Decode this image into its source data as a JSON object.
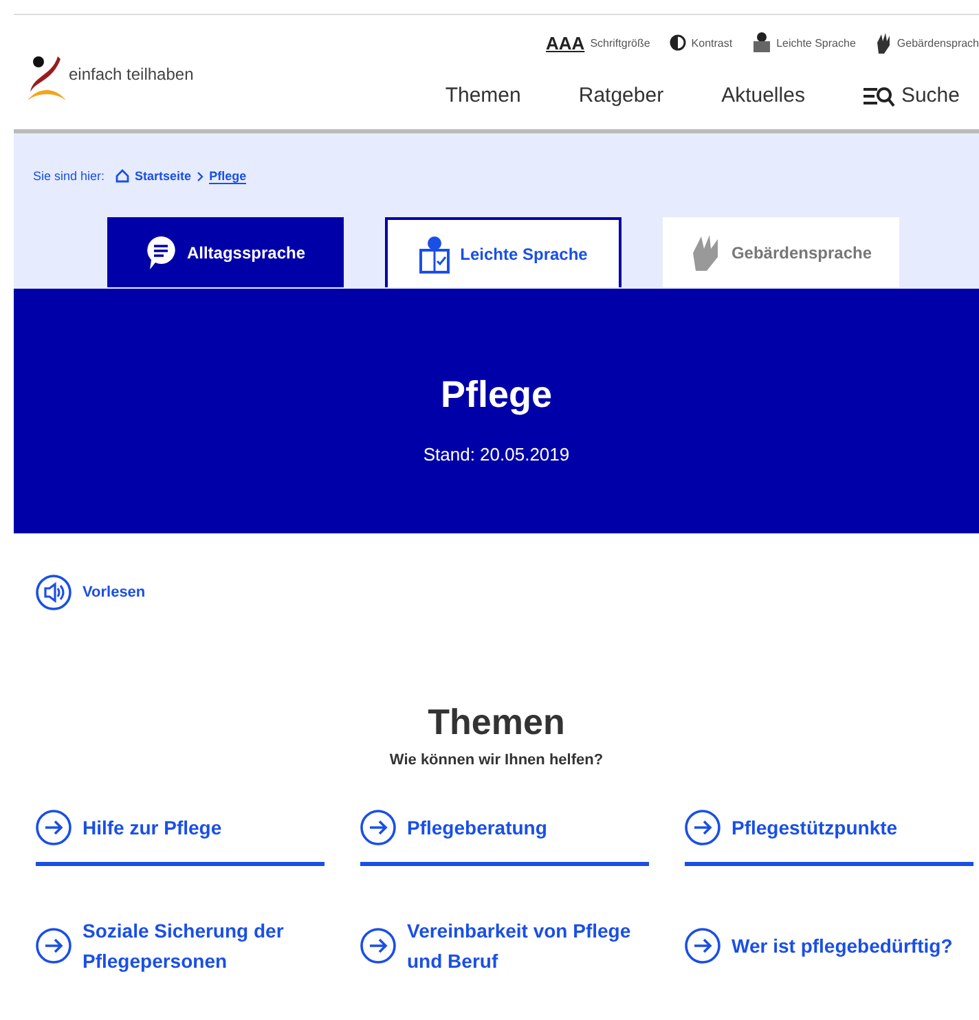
{
  "header": {
    "logo_text": "einfach teilhaben",
    "utility_links": [
      {
        "kind": "fontsize",
        "glyph": "AAA",
        "label": "Schriftgröße"
      },
      {
        "kind": "contrast",
        "label": "Kontrast"
      },
      {
        "kind": "easy",
        "label": "Leichte Sprache"
      },
      {
        "kind": "sign",
        "label": "Gebärdensprach"
      }
    ],
    "nav": [
      {
        "kind": "link",
        "label": "Themen"
      },
      {
        "kind": "link",
        "label": "Ratgeber"
      },
      {
        "kind": "link",
        "label": "Aktuelles"
      },
      {
        "kind": "search",
        "label": "Suche"
      }
    ]
  },
  "breadcrumb": {
    "prefix": "Sie sind hier:",
    "items": [
      {
        "label": "Startseite",
        "current": false
      },
      {
        "label": "Pflege",
        "current": true
      }
    ]
  },
  "tabs": [
    {
      "kind": "speech",
      "label": "Alltagssprache",
      "selected": true,
      "focused": false
    },
    {
      "kind": "easy",
      "label": "Leichte Sprache",
      "selected": false,
      "focused": true
    },
    {
      "kind": "sign",
      "label": "Gebärdensprache",
      "selected": false,
      "focused": false
    }
  ],
  "hero": {
    "title": "Pflege",
    "date": "Stand: 20.05.2019"
  },
  "read_aloud": "Vorlesen",
  "topics": {
    "title": "Themen",
    "subtitle": "Wie können wir Ihnen helfen?",
    "items": [
      {
        "label": "Hilfe zur Pflege"
      },
      {
        "label": "Pflegeberatung"
      },
      {
        "label": "Pflegestützpunkte"
      },
      {
        "label": "Soziale Sicherung der Pflegepersonen"
      },
      {
        "label": "Vereinbarkeit von Pflege und Beruf"
      },
      {
        "label": "Wer ist pflegebedürftig?"
      }
    ]
  }
}
